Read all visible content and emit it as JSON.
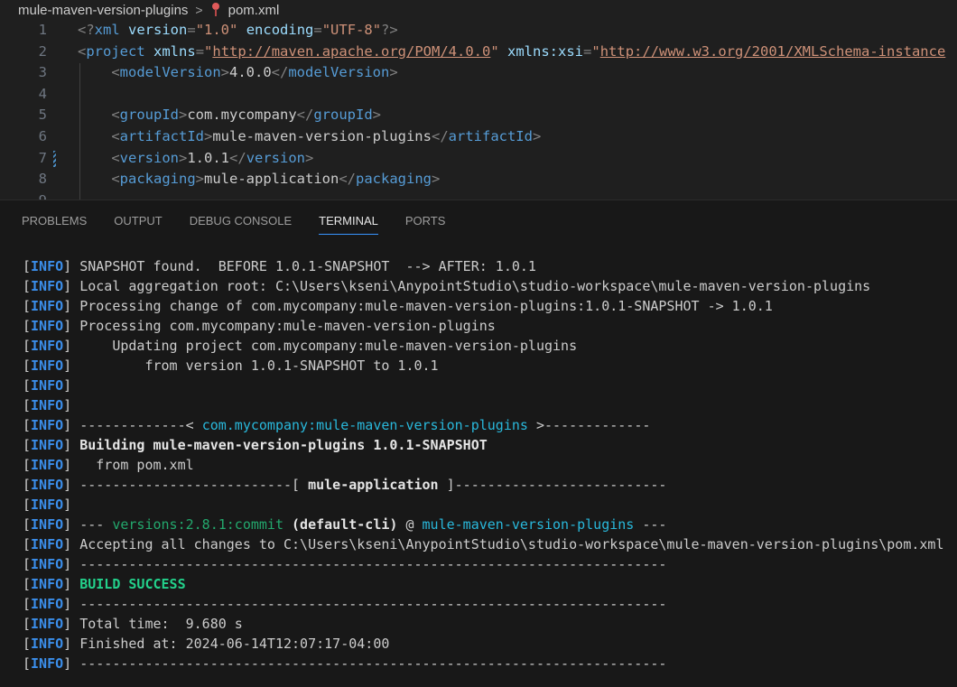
{
  "breadcrumb": {
    "folder": "mule-maven-version-plugins",
    "separator": ">",
    "file": "pom.xml",
    "file_icon": "xml-file-icon"
  },
  "editor": {
    "lines": [
      {
        "n": "1",
        "tokens": [
          [
            "br",
            "<?"
          ],
          [
            "tag",
            "xml"
          ],
          [
            "txt",
            " "
          ],
          [
            "attr",
            "version"
          ],
          [
            "br",
            "="
          ],
          [
            "str",
            "\"1.0\""
          ],
          [
            "txt",
            " "
          ],
          [
            "attr",
            "encoding"
          ],
          [
            "br",
            "="
          ],
          [
            "str",
            "\"UTF-8\""
          ],
          [
            "br",
            "?>"
          ]
        ]
      },
      {
        "n": "2",
        "tokens": [
          [
            "br",
            "<"
          ],
          [
            "tag",
            "project"
          ],
          [
            "txt",
            " "
          ],
          [
            "attr",
            "xmlns"
          ],
          [
            "br",
            "="
          ],
          [
            "str",
            "\""
          ],
          [
            "url",
            "http://maven.apache.org/POM/4.0.0"
          ],
          [
            "str",
            "\""
          ],
          [
            "txt",
            " "
          ],
          [
            "attr",
            "xmlns:xsi"
          ],
          [
            "br",
            "="
          ],
          [
            "str",
            "\""
          ],
          [
            "url",
            "http://www.w3.org/2001/XMLSchema-instance"
          ]
        ]
      },
      {
        "n": "3",
        "tokens": [
          [
            "txt",
            "    "
          ],
          [
            "br",
            "<"
          ],
          [
            "tag",
            "modelVersion"
          ],
          [
            "br",
            ">"
          ],
          [
            "txt",
            "4.0.0"
          ],
          [
            "br",
            "</"
          ],
          [
            "tag",
            "modelVersion"
          ],
          [
            "br",
            ">"
          ]
        ]
      },
      {
        "n": "4",
        "tokens": []
      },
      {
        "n": "5",
        "tokens": [
          [
            "txt",
            "    "
          ],
          [
            "br",
            "<"
          ],
          [
            "tag",
            "groupId"
          ],
          [
            "br",
            ">"
          ],
          [
            "txt",
            "com.mycompany"
          ],
          [
            "br",
            "</"
          ],
          [
            "tag",
            "groupId"
          ],
          [
            "br",
            ">"
          ]
        ]
      },
      {
        "n": "6",
        "tokens": [
          [
            "txt",
            "    "
          ],
          [
            "br",
            "<"
          ],
          [
            "tag",
            "artifactId"
          ],
          [
            "br",
            ">"
          ],
          [
            "txt",
            "mule-maven-version-plugins"
          ],
          [
            "br",
            "</"
          ],
          [
            "tag",
            "artifactId"
          ],
          [
            "br",
            ">"
          ]
        ]
      },
      {
        "n": "7",
        "modified": true,
        "tokens": [
          [
            "txt",
            "    "
          ],
          [
            "br",
            "<"
          ],
          [
            "tag",
            "version"
          ],
          [
            "br",
            ">"
          ],
          [
            "txt",
            "1.0.1"
          ],
          [
            "br",
            "</"
          ],
          [
            "tag",
            "version"
          ],
          [
            "br",
            ">"
          ]
        ]
      },
      {
        "n": "8",
        "tokens": [
          [
            "txt",
            "    "
          ],
          [
            "br",
            "<"
          ],
          [
            "tag",
            "packaging"
          ],
          [
            "br",
            ">"
          ],
          [
            "txt",
            "mule-application"
          ],
          [
            "br",
            "</"
          ],
          [
            "tag",
            "packaging"
          ],
          [
            "br",
            ">"
          ]
        ]
      },
      {
        "n": "9",
        "tokens": []
      }
    ]
  },
  "panel": {
    "tabs": [
      {
        "label": "PROBLEMS",
        "active": false
      },
      {
        "label": "OUTPUT",
        "active": false
      },
      {
        "label": "DEBUG CONSOLE",
        "active": false
      },
      {
        "label": "TERMINAL",
        "active": true
      },
      {
        "label": "PORTS",
        "active": false
      }
    ]
  },
  "terminal": {
    "level": "INFO",
    "lines": [
      [
        [
          "t",
          "SNAPSHOT found.  BEFORE 1.0.1-SNAPSHOT  --> AFTER: 1.0.1"
        ]
      ],
      [
        [
          "t",
          "Local aggregation root: C:\\Users\\kseni\\AnypointStudio\\studio-workspace\\mule-maven-version-plugins"
        ]
      ],
      [
        [
          "t",
          "Processing change of com.mycompany:mule-maven-version-plugins:1.0.1-SNAPSHOT -> 1.0.1"
        ]
      ],
      [
        [
          "t",
          "Processing com.mycompany:mule-maven-version-plugins"
        ]
      ],
      [
        [
          "t",
          "    Updating project com.mycompany:mule-maven-version-plugins"
        ]
      ],
      [
        [
          "t",
          "        from version 1.0.1-SNAPSHOT to 1.0.1"
        ]
      ],
      [],
      [],
      [
        [
          "t",
          "-------------< "
        ],
        [
          "cyan",
          "com.mycompany:mule-maven-version-plugins"
        ],
        [
          "t",
          " >-------------"
        ]
      ],
      [
        [
          "bold",
          "Building mule-maven-version-plugins 1.0.1-SNAPSHOT"
        ]
      ],
      [
        [
          "t",
          "  from pom.xml"
        ]
      ],
      [
        [
          "t",
          "--------------------------[ "
        ],
        [
          "bold",
          "mule-application"
        ],
        [
          "t",
          " ]--------------------------"
        ]
      ],
      [],
      [
        [
          "t",
          "--- "
        ],
        [
          "green",
          "versions:2.8.1:commit"
        ],
        [
          "t",
          " "
        ],
        [
          "bold",
          "(default-cli)"
        ],
        [
          "t",
          " @ "
        ],
        [
          "cyan",
          "mule-maven-version-plugins"
        ],
        [
          "t",
          " ---"
        ]
      ],
      [
        [
          "t",
          "Accepting all changes to C:\\Users\\kseni\\AnypointStudio\\studio-workspace\\mule-maven-version-plugins\\pom.xml"
        ]
      ],
      [
        [
          "t",
          "------------------------------------------------------------------------"
        ]
      ],
      [
        [
          "success",
          "BUILD SUCCESS"
        ]
      ],
      [
        [
          "t",
          "------------------------------------------------------------------------"
        ]
      ],
      [
        [
          "t",
          "Total time:  9.680 s"
        ]
      ],
      [
        [
          "t",
          "Finished at: 2024-06-14T12:07:17-04:00"
        ]
      ],
      [
        [
          "t",
          "------------------------------------------------------------------------"
        ]
      ]
    ]
  },
  "colors": {
    "background": "#1f1f1f",
    "panel_background": "#181818",
    "tab_active_border": "#3794ff",
    "info_level": "#3b8eea",
    "success": "#23d18b"
  }
}
